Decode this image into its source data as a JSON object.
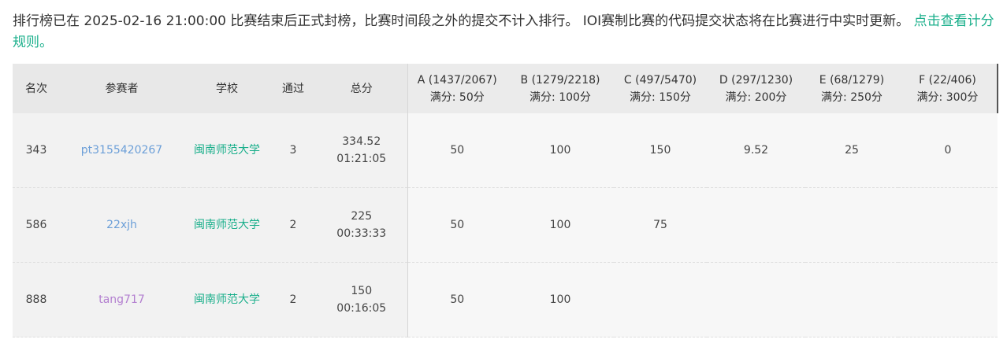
{
  "notice": {
    "text": "排行榜已在 2025-02-16 21:00:00 比赛结束后正式封榜，比赛时间段之外的提交不计入排行。 IOI赛制比赛的代码提交状态将在比赛进行中实时更新。",
    "link": "点击查看计分规则。"
  },
  "header": {
    "rank": "名次",
    "user": "参赛者",
    "school": "学校",
    "solved": "通过",
    "score": "总分",
    "problems": [
      {
        "title": "A (1437/2067)",
        "full": "满分: 50分"
      },
      {
        "title": "B (1279/2218)",
        "full": "满分: 100分"
      },
      {
        "title": "C (497/5470)",
        "full": "满分: 150分"
      },
      {
        "title": "D (297/1230)",
        "full": "满分: 200分"
      },
      {
        "title": "E (68/1279)",
        "full": "满分: 250分"
      },
      {
        "title": "F (22/406)",
        "full": "满分: 300分"
      }
    ]
  },
  "rows": [
    {
      "rank": "343",
      "user": "pt3155420267",
      "school": "闽南师范大学",
      "solved": "3",
      "score": "334.52",
      "time": "01:21:05",
      "problems": [
        "50",
        "100",
        "150",
        "9.52",
        "25",
        "0"
      ]
    },
    {
      "rank": "586",
      "user": "22xjh",
      "school": "闽南师范大学",
      "solved": "2",
      "score": "225",
      "time": "00:33:33",
      "problems": [
        "50",
        "100",
        "75",
        "",
        "",
        ""
      ]
    },
    {
      "rank": "888",
      "user": "tang717",
      "school": "闽南师范大学",
      "solved": "2",
      "score": "150",
      "time": "00:16:05",
      "problems": [
        "50",
        "100",
        "",
        "",
        "",
        ""
      ]
    }
  ],
  "colors": {
    "accent": "#1aaf8b",
    "partial": "#f0a030",
    "low": "#d03c3c",
    "user_blue": "#6c9fd8",
    "user_purple": "#b37fd0"
  }
}
